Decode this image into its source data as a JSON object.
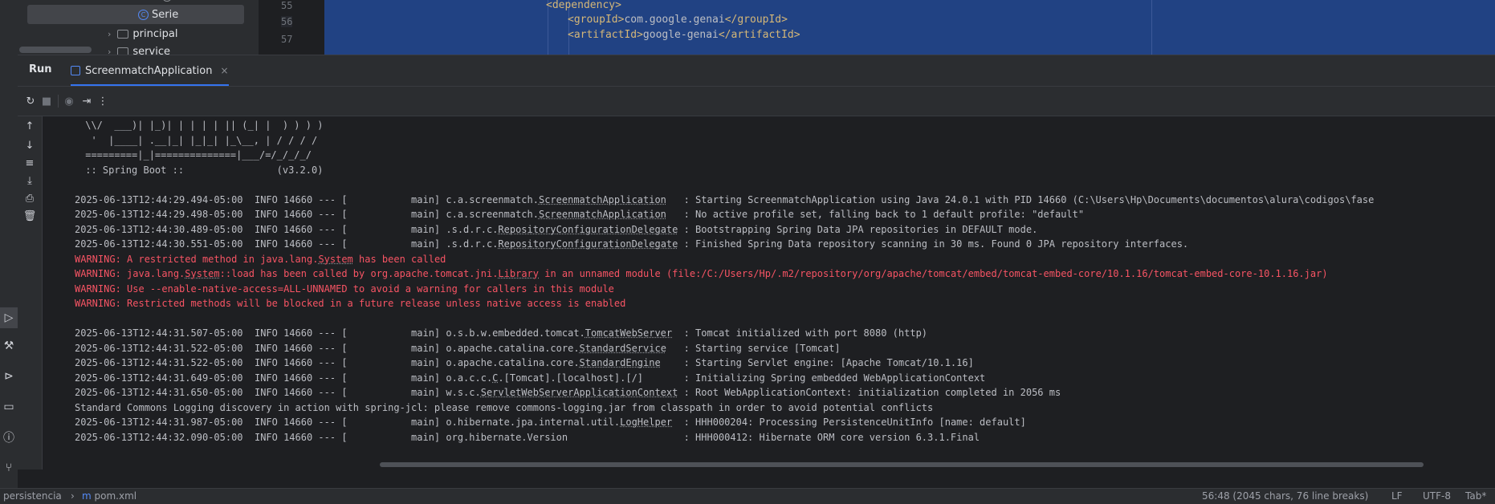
{
  "project_tree": {
    "items": [
      {
        "label": "Serie",
        "icon": "class-icon",
        "selected": true
      },
      {
        "label": "principal",
        "icon": "package-icon",
        "selected": false
      },
      {
        "label": "service",
        "icon": "package-icon",
        "selected": false
      }
    ]
  },
  "editor": {
    "line_numbers": [
      "55",
      "56",
      "57"
    ],
    "lines": [
      {
        "open": "<dependency>",
        "text": "",
        "close": ""
      },
      {
        "open": "<groupId>",
        "text": "com.google.genai",
        "close": "</groupId>"
      },
      {
        "open": "<artifactId>",
        "text": "google-genai",
        "close": "</artifactId>"
      }
    ]
  },
  "run_panel": {
    "title": "Run",
    "tab_label": "ScreenmatchApplication",
    "tab_close": "×",
    "toolbar_icons": [
      "rerun-icon",
      "stop-icon",
      "camera-icon",
      "exit-icon",
      "more-icon"
    ],
    "side_icons": [
      "arrow-up-icon",
      "arrow-down-icon",
      "soft-wrap-icon",
      "scroll-to-end-icon",
      "print-icon",
      "trash-icon"
    ]
  },
  "console": {
    "banner": [
      " \\\\/  ___)| |_)| | | | | || (_| |  ) ) ) )",
      "  '  |____| .__|_| |_|_| |_\\__, | / / / /",
      " =========|_|==============|___/=/_/_/_/",
      " :: Spring Boot ::                (v3.2.0)"
    ],
    "log_lines": [
      {
        "type": "info",
        "parts": [
          {
            "t": "2025-06-13T12:44:29.494-05:00  INFO 14660 --- [           main] c.a.screenmatch."
          },
          {
            "t": "ScreenmatchApplication",
            "u": true
          },
          {
            "t": "   : Starting ScreenmatchApplication using Java 24.0.1 with PID 14660 (C:\\Users\\Hp\\Documents\\documentos\\alura\\codigos\\fase"
          }
        ]
      },
      {
        "type": "info",
        "parts": [
          {
            "t": "2025-06-13T12:44:29.498-05:00  INFO 14660 --- [           main] c.a.screenmatch."
          },
          {
            "t": "ScreenmatchApplication",
            "u": true
          },
          {
            "t": "   : No active profile set, falling back to 1 default profile: \"default\""
          }
        ]
      },
      {
        "type": "info",
        "parts": [
          {
            "t": "2025-06-13T12:44:30.489-05:00  INFO 14660 --- [           main] .s.d.r.c."
          },
          {
            "t": "RepositoryConfigurationDelegate",
            "u": true
          },
          {
            "t": " : Bootstrapping Spring Data JPA repositories in DEFAULT mode."
          }
        ]
      },
      {
        "type": "info",
        "parts": [
          {
            "t": "2025-06-13T12:44:30.551-05:00  INFO 14660 --- [           main] .s.d.r.c."
          },
          {
            "t": "RepositoryConfigurationDelegate",
            "u": true
          },
          {
            "t": " : Finished Spring Data repository scanning in 30 ms. Found 0 JPA repository interfaces."
          }
        ]
      },
      {
        "type": "warn",
        "parts": [
          {
            "t": "WARNING: A restricted method in java.lang."
          },
          {
            "t": "System",
            "u": true
          },
          {
            "t": " has been called"
          }
        ]
      },
      {
        "type": "warn",
        "parts": [
          {
            "t": "WARNING: java.lang."
          },
          {
            "t": "System",
            "u": true
          },
          {
            "t": "::load has been called by org.apache.tomcat.jni."
          },
          {
            "t": "Library",
            "u": true
          },
          {
            "t": " in an unnamed module (file:/C:/Users/Hp/.m2/repository/org/apache/tomcat/embed/tomcat-embed-core/10.1.16/tomcat-embed-core-10.1.16.jar)"
          }
        ]
      },
      {
        "type": "warn",
        "parts": [
          {
            "t": "WARNING: Use --enable-native-access=ALL-UNNAMED to avoid a warning for callers in this module"
          }
        ]
      },
      {
        "type": "warn",
        "parts": [
          {
            "t": "WARNING: Restricted methods will be blocked in a future release unless native access is enabled"
          }
        ]
      },
      {
        "type": "blank",
        "parts": [
          {
            "t": ""
          }
        ]
      },
      {
        "type": "info",
        "parts": [
          {
            "t": "2025-06-13T12:44:31.507-05:00  INFO 14660 --- [           main] o.s.b.w.embedded.tomcat."
          },
          {
            "t": "TomcatWebServer",
            "u": true
          },
          {
            "t": "  : Tomcat initialized with port 8080 (http)"
          }
        ]
      },
      {
        "type": "info",
        "parts": [
          {
            "t": "2025-06-13T12:44:31.522-05:00  INFO 14660 --- [           main] o.apache.catalina.core."
          },
          {
            "t": "StandardService",
            "u": true
          },
          {
            "t": "   : Starting service [Tomcat]"
          }
        ]
      },
      {
        "type": "info",
        "parts": [
          {
            "t": "2025-06-13T12:44:31.522-05:00  INFO 14660 --- [           main] o.apache.catalina.core."
          },
          {
            "t": "StandardEngine",
            "u": true
          },
          {
            "t": "    : Starting Servlet engine: [Apache Tomcat/10.1.16]"
          }
        ]
      },
      {
        "type": "info",
        "parts": [
          {
            "t": "2025-06-13T12:44:31.649-05:00  INFO 14660 --- [           main] o.a.c.c."
          },
          {
            "t": "C",
            "u": true
          },
          {
            "t": ".[Tomcat].[localhost].[/]       : Initializing Spring embedded WebApplicationContext"
          }
        ]
      },
      {
        "type": "info",
        "parts": [
          {
            "t": "2025-06-13T12:44:31.650-05:00  INFO 14660 --- [           main] w.s.c."
          },
          {
            "t": "ServletWebServerApplicationContext",
            "u": true
          },
          {
            "t": " : Root WebApplicationContext: initialization completed in 2056 ms"
          }
        ]
      },
      {
        "type": "info",
        "parts": [
          {
            "t": "Standard Commons Logging discovery in action with spring-jcl: please remove commons-logging.jar from classpath in order to avoid potential conflicts"
          }
        ]
      },
      {
        "type": "info",
        "parts": [
          {
            "t": "2025-06-13T12:44:31.987-05:00  INFO 14660 --- [           main] o.hibernate.jpa.internal.util."
          },
          {
            "t": "LogHelper",
            "u": true
          },
          {
            "t": "  : HHH000204: Processing PersistenceUnitInfo [name: default]"
          }
        ]
      },
      {
        "type": "info",
        "parts": [
          {
            "t": "2025-06-13T12:44:32.090-05:00  INFO 14660 --- [           main] org.hibernate.Version                    : HHH000412: Hibernate ORM core version 6.3.1.Final"
          }
        ]
      }
    ]
  },
  "status_bar": {
    "breadcrumb_project": "persistencia",
    "breadcrumb_file": "pom.xml",
    "position": "56:48 (2045 chars, 76 line breaks)",
    "line_ending": "LF",
    "encoding": "UTF-8",
    "indent": "Tab*"
  },
  "colors": {
    "background": "#1e1f22",
    "panel": "#2b2d30",
    "selection": "#214283",
    "warning": "#f75464",
    "accent": "#3574f0"
  }
}
